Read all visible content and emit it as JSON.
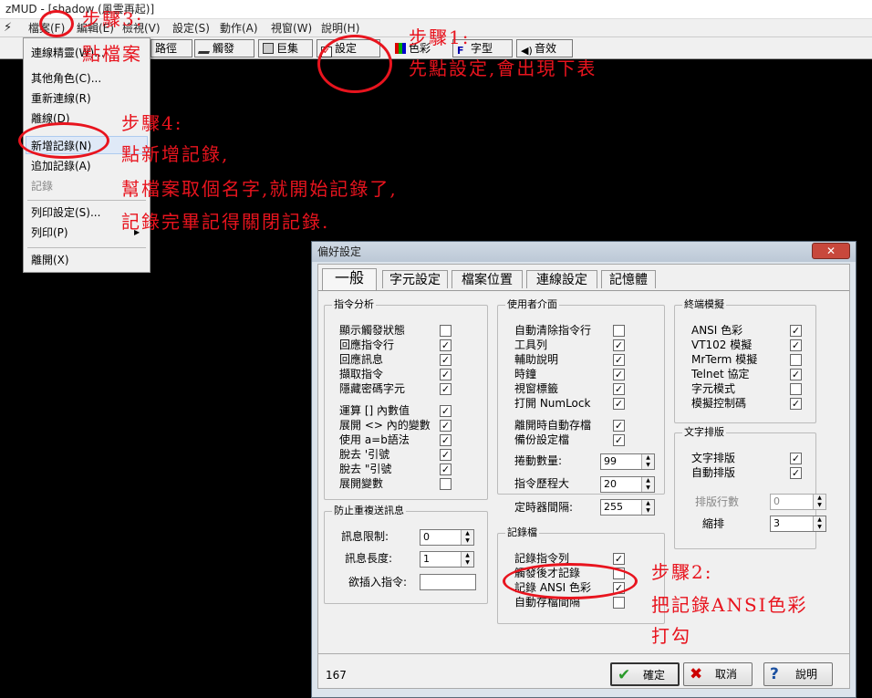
{
  "app": {
    "title": "zMUD - [shadow (風雲再起)]"
  },
  "menu": [
    "檔案(F)",
    "編輯(E)",
    "檢視(V)",
    "設定(S)",
    "動作(A)",
    "視窗(W)",
    "說明(H)"
  ],
  "toolbar": {
    "path": "路徑",
    "trigger": "觸發",
    "macro": "巨集",
    "settings": "設定",
    "color": "色彩",
    "font": "字型",
    "sound": "音效"
  },
  "file_menu": {
    "items": [
      "連線精靈(W)...",
      "其他角色(C)...",
      "重新連線(R)",
      "離線(D)",
      "新增記錄(N)",
      "追加記錄(A)",
      "記錄",
      "列印設定(S)...",
      "列印(P)",
      "離開(X)"
    ]
  },
  "annotations": {
    "step3": [
      "步驟3:",
      "點檔案"
    ],
    "step1": [
      "步驟1:",
      "先點設定,會出現下表"
    ],
    "step4": [
      "步驟4:",
      "點新增記錄,",
      "幫檔案取個名字,就開始記錄了,",
      "記錄完畢記得關閉記錄."
    ],
    "step2": [
      "步驟2:",
      "把記錄ANSI色彩",
      "打勾"
    ]
  },
  "dialog": {
    "title": "偏好設定",
    "close": "✕",
    "tabs": [
      "一般",
      "字元設定",
      "檔案位置",
      "連線設定",
      "記憶體"
    ],
    "cmd_group": {
      "title": "指令分析",
      "items": [
        {
          "label": "顯示觸發狀態",
          "checked": false
        },
        {
          "label": "回應指令行",
          "checked": true
        },
        {
          "label": "回應訊息",
          "checked": true
        },
        {
          "label": "擷取指令",
          "checked": true
        },
        {
          "label": "隱藏密碼字元",
          "checked": true
        },
        {
          "label": "運算 [] 內數值",
          "checked": true
        },
        {
          "label": "展開 <> 內的變數",
          "checked": true
        },
        {
          "label": "使用 a=b語法",
          "checked": true
        },
        {
          "label": "脫去 '引號",
          "checked": true
        },
        {
          "label": "脫去 \"引號",
          "checked": true
        },
        {
          "label": "展開變數",
          "checked": false
        }
      ]
    },
    "ui_group": {
      "title": "使用者介面",
      "items": [
        {
          "label": "自動清除指令行",
          "checked": false
        },
        {
          "label": "工具列",
          "checked": true
        },
        {
          "label": "輔助說明",
          "checked": true
        },
        {
          "label": "時鐘",
          "checked": true
        },
        {
          "label": "視窗標籤",
          "checked": true
        },
        {
          "label": "打開 NumLock",
          "checked": true
        },
        {
          "label": "離開時自動存檔",
          "checked": true
        },
        {
          "label": "備份設定檔",
          "checked": true
        }
      ],
      "scroll_label": "捲動數量:",
      "scroll_value": "99",
      "history_label": "指令歷程大",
      "history_value": "20",
      "timer_label": "定時器間隔:",
      "timer_value": "255"
    },
    "term_group": {
      "title": "終端模擬",
      "items": [
        {
          "label": "ANSI 色彩",
          "checked": true
        },
        {
          "label": "VT102 模擬",
          "checked": true
        },
        {
          "label": "MrTerm 模擬",
          "checked": false
        },
        {
          "label": "Telnet 協定",
          "checked": true
        },
        {
          "label": "字元模式",
          "checked": false
        },
        {
          "label": "模擬控制碼",
          "checked": true
        }
      ]
    },
    "text_group": {
      "title": "文字排版",
      "items": [
        {
          "label": "文字排版",
          "checked": true
        },
        {
          "label": "自動排版",
          "checked": true
        }
      ],
      "rows_label": "排版行數",
      "rows_value": "0",
      "indent_label": "縮排",
      "indent_value": "3"
    },
    "spam_group": {
      "title": "防止重複送訊息",
      "limit_label": "訊息限制:",
      "limit_value": "0",
      "length_label": "訊息長度:",
      "length_value": "1",
      "insert_label": "欲插入指令:",
      "insert_value": ""
    },
    "log_group": {
      "title": "記錄檔",
      "items": [
        {
          "label": "記錄指令列",
          "checked": true
        },
        {
          "label": "觸發後才記錄",
          "checked": false
        },
        {
          "label": "記錄 ANSI 色彩",
          "checked": true
        },
        {
          "label": "自動存檔間隔",
          "checked": false
        }
      ]
    },
    "status_number": "167",
    "ok": "確定",
    "cancel": "取消",
    "help": "說明"
  },
  "colors": {
    "accent": "#e8141e"
  }
}
